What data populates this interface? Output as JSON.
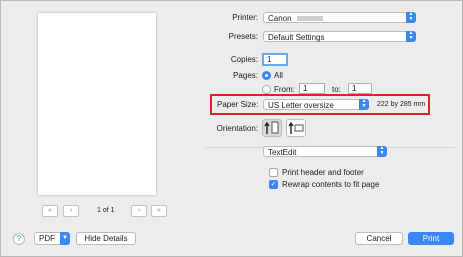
{
  "pager": {
    "first": "«",
    "prev": "‹",
    "page_label": "1 of 1",
    "next": "›",
    "last": "»"
  },
  "printer": {
    "label": "Printer:",
    "value": "Canon"
  },
  "presets": {
    "label": "Presets:",
    "value": "Default Settings"
  },
  "copies": {
    "label": "Copies:",
    "value": "1"
  },
  "pages": {
    "label": "Pages:",
    "all": "All",
    "from": "From:",
    "from_value": "1",
    "to": "to:",
    "to_value": "1"
  },
  "paper_size": {
    "label": "Paper Size:",
    "value": "US Letter oversize",
    "dims": "222 by 285 mm"
  },
  "orientation": {
    "label": "Orientation:",
    "portrait_icon": "portrait-icon",
    "landscape_icon": "landscape-icon"
  },
  "section": {
    "value": "TextEdit"
  },
  "options": [
    {
      "label": "Print header and footer",
      "checked": false
    },
    {
      "label": "Rewrap contents to fit page",
      "checked": true
    }
  ],
  "footer": {
    "help": "?",
    "pdf": "PDF",
    "hide_details": "Hide Details",
    "cancel": "Cancel",
    "print": "Print"
  },
  "colors": {
    "accent": "#3b87f5",
    "highlight": "#e0202a"
  }
}
